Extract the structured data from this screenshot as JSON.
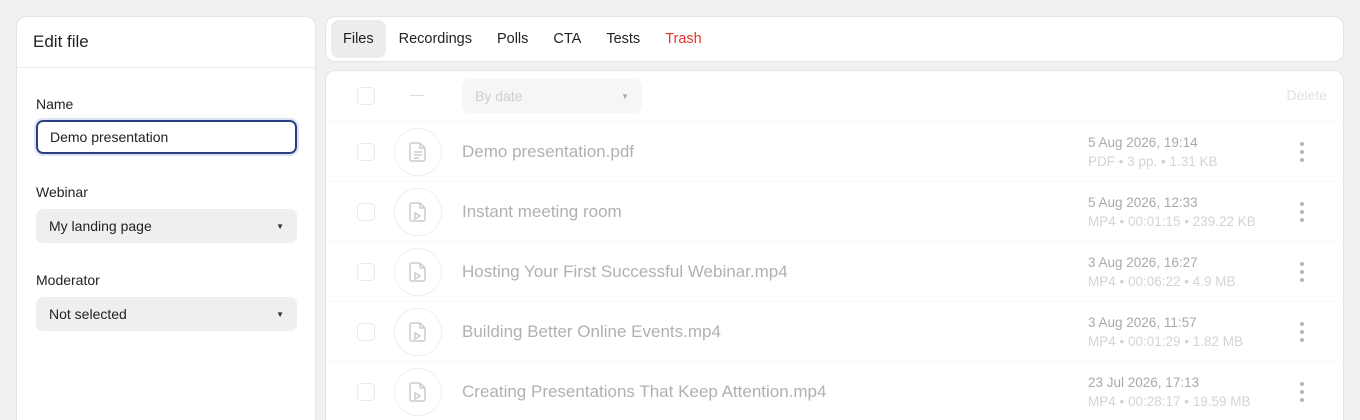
{
  "edit_panel": {
    "title": "Edit file",
    "name_label": "Name",
    "name_value": "Demo presentation",
    "webinar_label": "Webinar",
    "webinar_value": "My landing page",
    "moderator_label": "Moderator",
    "moderator_value": "Not selected"
  },
  "tabs": [
    {
      "label": "Files",
      "active": true
    },
    {
      "label": "Recordings",
      "active": false
    },
    {
      "label": "Polls",
      "active": false
    },
    {
      "label": "CTA",
      "active": false
    },
    {
      "label": "Tests",
      "active": false
    },
    {
      "label": "Trash",
      "active": false,
      "color": "#e5332a"
    }
  ],
  "toolbar": {
    "dash": "—",
    "sort_value": "By date",
    "delete_label": "Delete"
  },
  "files": [
    {
      "name": "Demo presentation.pdf",
      "date": "5 Aug 2026, 19:14",
      "meta": "PDF • 3 pp. • 1.31 KB",
      "icon": "presentation-file-icon"
    },
    {
      "name": "Instant meeting room",
      "date": "5 Aug 2026, 12:33",
      "meta": "MP4 • 00:01:15 • 239.22 KB",
      "icon": "video-file-icon"
    },
    {
      "name": "Hosting Your First Successful Webinar.mp4",
      "date": "3 Aug 2026, 16:27",
      "meta": "MP4 • 00:06:22 • 4.9 MB",
      "icon": "video-file-icon"
    },
    {
      "name": "Building Better Online Events.mp4",
      "date": "3 Aug 2026, 11:57",
      "meta": "MP4 • 00:01:29 • 1.82 MB",
      "icon": "video-file-icon"
    },
    {
      "name": "Creating Presentations That Keep Attention.mp4",
      "date": "23 Jul 2026, 17:13",
      "meta": "MP4 • 00:28:17 • 19.59 MB",
      "icon": "video-file-icon"
    }
  ],
  "colors": {
    "focus_border": "#2a3f7d",
    "trash_red": "#e5332a",
    "background": "#f1f1f1"
  }
}
